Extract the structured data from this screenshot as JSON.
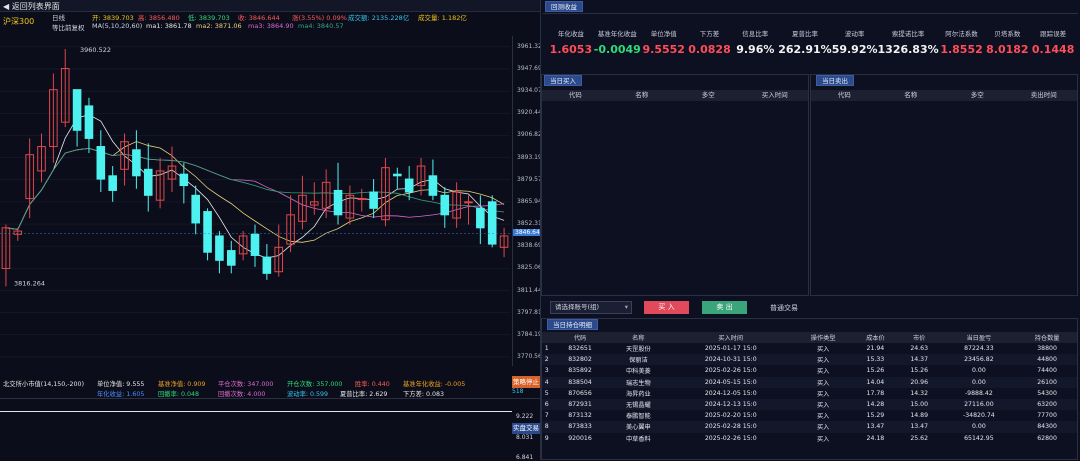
{
  "header": {
    "back_label": "返回列表界面"
  },
  "info": {
    "code": "沪深300",
    "period": "日线",
    "adj": "等比前复权",
    "open": "开: 3839.703",
    "high": "高: 3856.480",
    "low": "低: 3839.703",
    "close": "收: 3846.644",
    "change": "涨(3.55%) 0.09%",
    "amount": "成交额: 2135.228亿",
    "volume": "成交量: 1.182亿",
    "ma_title": "MA(5,10,20,60)",
    "ma1": "ma1: 3861.78",
    "ma2": "ma2: 3871.06",
    "ma3": "ma3: 3864.90",
    "ma4": "ma4: 3840.57"
  },
  "chart_data": {
    "type": "candlestick",
    "y_ticks": [
      "3961.322",
      "3947.697",
      "3934.072",
      "3920.446",
      "3906.821",
      "3893.195",
      "3879.570",
      "3865.945",
      "3852.319",
      "3838.694",
      "3825.068",
      "3811.443",
      "3797.818",
      "3784.192",
      "3770.567"
    ],
    "ylim": [
      3765,
      3968
    ],
    "annotations": {
      "high": "3960.522",
      "low": "3816.264",
      "last": "3846.644"
    },
    "candles": [
      [
        3825,
        3850,
        3852,
        3814
      ],
      [
        3846,
        3848,
        3850,
        3842
      ],
      [
        3868,
        3895,
        3905,
        3856
      ],
      [
        3885,
        3900,
        3908,
        3878
      ],
      [
        3900,
        3935,
        3945,
        3890
      ],
      [
        3915,
        3948,
        3960,
        3912
      ],
      [
        3935,
        3910,
        3925,
        3900
      ],
      [
        3925,
        3905,
        3930,
        3896
      ],
      [
        3900,
        3880,
        3910,
        3872
      ],
      [
        3882,
        3873,
        3888,
        3866
      ],
      [
        3886,
        3903,
        3908,
        3876
      ],
      [
        3898,
        3882,
        3910,
        3874
      ],
      [
        3886,
        3870,
        3902,
        3860
      ],
      [
        3867,
        3885,
        3893,
        3862
      ],
      [
        3880,
        3888,
        3900,
        3872
      ],
      [
        3883,
        3876,
        3890,
        3865
      ],
      [
        3870,
        3853,
        3876,
        3846
      ],
      [
        3860,
        3835,
        3862,
        3830
      ],
      [
        3845,
        3830,
        3848,
        3822
      ],
      [
        3836,
        3827,
        3842,
        3822
      ],
      [
        3834,
        3845,
        3848,
        3830
      ],
      [
        3846,
        3833,
        3852,
        3826
      ],
      [
        3832,
        3822,
        3840,
        3818
      ],
      [
        3823,
        3838,
        3852,
        3820
      ],
      [
        3840,
        3858,
        3870,
        3835
      ],
      [
        3854,
        3870,
        3882,
        3849
      ],
      [
        3864,
        3866,
        3878,
        3858
      ],
      [
        3862,
        3878,
        3886,
        3856
      ],
      [
        3873,
        3858,
        3890,
        3852
      ],
      [
        3856,
        3870,
        3876,
        3852
      ],
      [
        3868,
        3868,
        3874,
        3860
      ],
      [
        3872,
        3862,
        3880,
        3856
      ],
      [
        3855,
        3887,
        3893,
        3851
      ],
      [
        3883,
        3882,
        3887,
        3874
      ],
      [
        3880,
        3872,
        3888,
        3867
      ],
      [
        3876,
        3888,
        3893,
        3870
      ],
      [
        3882,
        3870,
        3892,
        3867
      ],
      [
        3870,
        3858,
        3875,
        3850
      ],
      [
        3856,
        3872,
        3878,
        3850
      ],
      [
        3866,
        3866,
        3870,
        3852
      ],
      [
        3862,
        3850,
        3870,
        3840
      ],
      [
        3866,
        3840,
        3870,
        3838
      ],
      [
        3838,
        3845,
        3850,
        3832
      ]
    ]
  },
  "bottom": {
    "name": "北交所小市值(14,150,-200)",
    "net": "单位净值: 9.555",
    "bench_net": "基准净值: 0.909",
    "trades": "平仓次数: 347.000",
    "open_trades": "开仓次数: 357.000",
    "win": "胜率: 0.440",
    "bench_ret": "基准年化收益: -0.005",
    "ret": "年化收益: 1.605",
    "dd": "回撤率: 0.048",
    "maxdd": "回撤次数: 4.000",
    "vol": "波动率: 0.599",
    "sharpe": "夏普比率: 2.629",
    "downside": "下方差: 0.083",
    "sig1": "策略停止",
    "val1": "9.222",
    "sig2": "实盘交易",
    "val2": "8.031",
    "val3": "6.841",
    "val4": "518"
  },
  "right": {
    "tab_backtest": "回测收益",
    "metric_labels": [
      "年化收益",
      "基准年化收益",
      "单位净值",
      "下方差",
      "信息比率",
      "夏普比率",
      "波动率",
      "索提诺比率",
      "阿尔法系数",
      "贝塔系数",
      "跟踪误差"
    ],
    "metric_values": [
      "1.6053",
      "-0.0049",
      "9.5552",
      "0.0828",
      "9.96%",
      "262.91%",
      "59.92%",
      "1326.83%",
      "1.8552",
      "8.0182",
      "0.1448"
    ],
    "buy_tab": "当日买入",
    "sell_tab": "当日卖出",
    "buy_cols": [
      "代码",
      "名称",
      "多空",
      "买入时间"
    ],
    "sell_cols": [
      "代码",
      "名称",
      "多空",
      "卖出时间"
    ],
    "account_placeholder": "请选择账号(组)",
    "buy_btn": "买 入",
    "sell_btn": "卖 出",
    "normal_trade": "普通交易",
    "holdings_tab": "当日持仓明细",
    "hold_cols": [
      "",
      "代码",
      "名称",
      "买入时间",
      "操作类型",
      "成本价",
      "市价",
      "当日盈亏",
      "持仓数量"
    ],
    "holdings": [
      [
        "1",
        "832651",
        "天罡股份",
        "2025-01-17 15:0",
        "买入",
        "21.94",
        "24.63",
        "87224.33",
        "38800"
      ],
      [
        "2",
        "832802",
        "保丽洁",
        "2024-10-31 15:0",
        "买入",
        "15.33",
        "14.37",
        "23456.82",
        "44800"
      ],
      [
        "3",
        "835892",
        "中科美菱",
        "2025-02-26 15:0",
        "买入",
        "15.26",
        "15.26",
        "0.00",
        "74400"
      ],
      [
        "4",
        "838504",
        "瑞志生物",
        "2024-05-15 15:0",
        "买入",
        "14.04",
        "20.96",
        "0.00",
        "26100"
      ],
      [
        "5",
        "870656",
        "海昇药业",
        "2024-12-05 15:0",
        "买入",
        "17.78",
        "14.32",
        "-9888.42",
        "54300"
      ],
      [
        "6",
        "872931",
        "无锡晶耀",
        "2024-12-13 15:0",
        "买入",
        "14.28",
        "15.00",
        "27116.00",
        "63200"
      ],
      [
        "7",
        "873132",
        "泰鹏智能",
        "2025-02-20 15:0",
        "买入",
        "15.29",
        "14.89",
        "-34820.74",
        "77700"
      ],
      [
        "8",
        "873833",
        "美心翼申",
        "2025-02-28 15:0",
        "买入",
        "13.47",
        "13.47",
        "0.00",
        "84300"
      ],
      [
        "9",
        "920016",
        "中草香料",
        "2025-02-26 15:0",
        "买入",
        "24.18",
        "25.62",
        "65142.95",
        "62800"
      ]
    ]
  },
  "colors": {
    "up": "#e0464c",
    "down": "#4df2f0",
    "ma1": "#e8e8e8",
    "ma2": "#e6d27a",
    "ma3": "#d86ad0",
    "ma4": "#3aa37a",
    "red": "#ff4d5a",
    "green": "#2fdc7a",
    "white": "#f2f2f2"
  }
}
